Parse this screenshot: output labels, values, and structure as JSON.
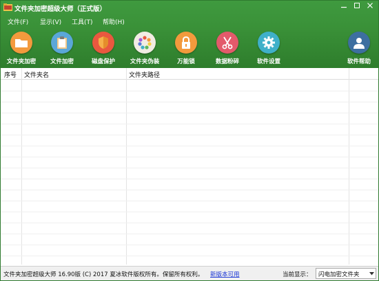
{
  "window": {
    "title": "文件夹加密超级大师（正式版）",
    "controls": [
      "minimize",
      "maximize",
      "close"
    ]
  },
  "menu": {
    "items": [
      {
        "label": "文件(F)"
      },
      {
        "label": "显示(V)"
      },
      {
        "label": "工具(T)"
      },
      {
        "label": "帮助(H)"
      }
    ]
  },
  "toolbar": {
    "items": [
      {
        "label": "文件夹加密",
        "icon": "folder-icon",
        "color": "#f39a3d"
      },
      {
        "label": "文件加密",
        "icon": "clipboard-icon",
        "color": "#5aa7d8"
      },
      {
        "label": "磁盘保护",
        "icon": "shield-icon",
        "color": "#e9583f"
      },
      {
        "label": "文件夹伪装",
        "icon": "palette-icon",
        "color": "#f1ece3"
      },
      {
        "label": "万能锁",
        "icon": "lock-icon",
        "color": "#f39a3d"
      },
      {
        "label": "数据粉碎",
        "icon": "scissors-icon",
        "color": "#e35a6b"
      },
      {
        "label": "软件设置",
        "icon": "gear-icon",
        "color": "#3fb0c9"
      },
      {
        "label": "软件帮助",
        "icon": "user-icon",
        "color": "#3d6fa0"
      }
    ]
  },
  "grid": {
    "columns": [
      "序号",
      "文件夹名",
      "文件夹路径"
    ],
    "rows": []
  },
  "status": {
    "text": "文件夹加密超级大师 16.90版 (C) 2017  夏冰软件版权所有。保留所有权利。",
    "new_version_link": "新版本可用",
    "current_display_label": "当前显示：",
    "current_display_value": "闪电加密文件夹"
  },
  "colors": {
    "header_green": "#3a9138",
    "link_blue": "#1a35d6"
  }
}
